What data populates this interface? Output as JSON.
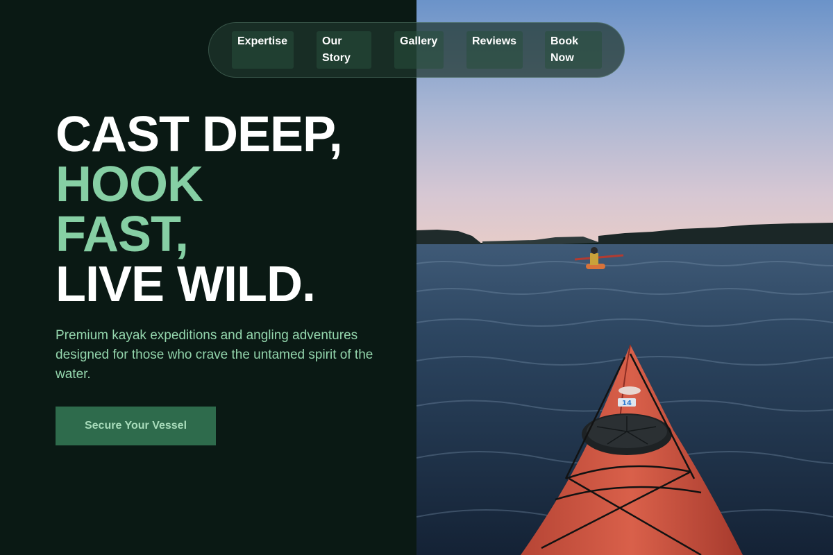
{
  "nav": {
    "items": [
      {
        "lines": [
          "Expertise"
        ]
      },
      {
        "lines": [
          "Our",
          "Story"
        ]
      },
      {
        "lines": [
          "Gallery"
        ]
      },
      {
        "lines": [
          "Reviews"
        ]
      },
      {
        "lines": [
          "Book",
          "Now"
        ]
      }
    ]
  },
  "hero": {
    "headline": {
      "line1": "CAST DEEP,",
      "line2": "HOOK",
      "line3": "FAST,",
      "line4": "LIVE WILD."
    },
    "subtext": "Premium kayak expeditions and angling adventures designed for those who crave the untamed spirit of the water.",
    "cta_label": "Secure Your Vessel"
  },
  "photo": {
    "bow_number": "14"
  },
  "colors": {
    "background": "#0a1914",
    "accent_green": "#86cfa4",
    "cta_background": "#2e6b4c",
    "subtext": "#94d6ad"
  }
}
